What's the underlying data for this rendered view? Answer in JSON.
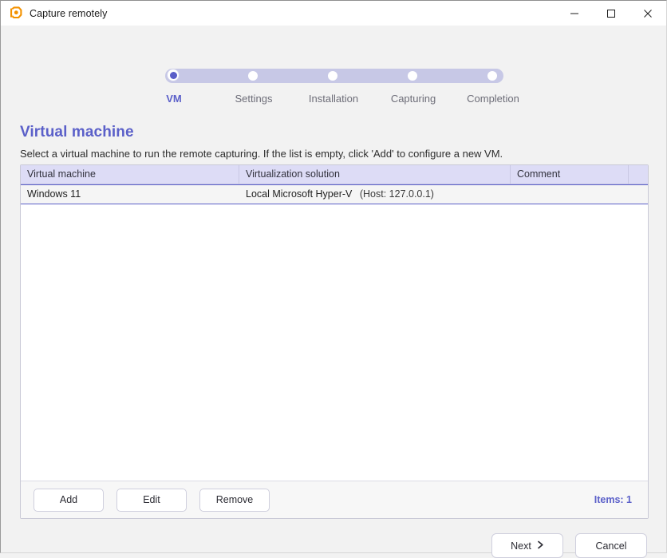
{
  "window": {
    "title": "Capture remotely",
    "app_icon": "app-logo-icon",
    "controls": {
      "minimize": "minimize-icon",
      "maximize": "maximize-icon",
      "close": "close-icon"
    }
  },
  "stepper": {
    "active_index": 0,
    "steps": [
      {
        "label": "VM"
      },
      {
        "label": "Settings"
      },
      {
        "label": "Installation"
      },
      {
        "label": "Capturing"
      },
      {
        "label": "Completion"
      }
    ]
  },
  "page": {
    "title": "Virtual machine",
    "description": "Select a virtual machine to run the remote capturing. If the list is empty, click 'Add' to configure a new VM."
  },
  "grid": {
    "columns": [
      "Virtual machine",
      "Virtualization solution",
      "Comment",
      ""
    ],
    "rows": [
      {
        "virtual_machine": "Windows 11",
        "virtualization_solution": "Local Microsoft Hyper-V",
        "virtualization_host": "(Host: 127.0.0.1)",
        "comment": "",
        "selected": true
      }
    ]
  },
  "panel_footer": {
    "add_label": "Add",
    "edit_label": "Edit",
    "remove_label": "Remove",
    "items_label": "Items: 1"
  },
  "bottom_actions": {
    "next_label": "Next",
    "next_icon": "chevron-right-icon",
    "cancel_label": "Cancel"
  },
  "colors": {
    "accent": "#5b60c9",
    "stepper_bar": "#c7c8e6",
    "grid_header": "#dddcf6",
    "app_icon": "#f39200",
    "content_bg": "#f2f2f2"
  }
}
